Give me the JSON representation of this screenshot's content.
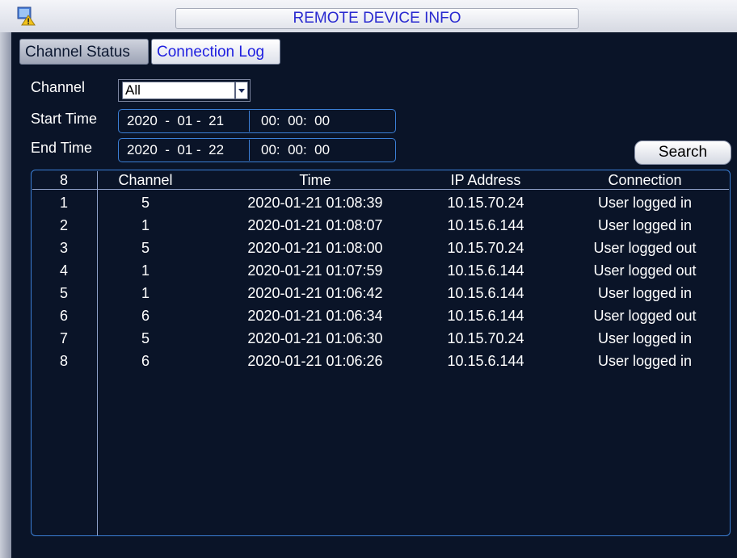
{
  "window": {
    "title": "REMOTE DEVICE INFO",
    "icon": "app-warning-icon"
  },
  "tabs": [
    {
      "label": "Channel Status",
      "active": false
    },
    {
      "label": "Connection Log",
      "active": true
    }
  ],
  "filters": {
    "channel_label": "Channel",
    "channel_value": "All",
    "start_label": "Start Time",
    "start_date": "2020  -  01 -  21",
    "start_time": "00:  00:  00",
    "end_label": "End Time",
    "end_date": "2020  -  01 -  22",
    "end_time": "00:  00:  00",
    "search_label": "Search"
  },
  "table": {
    "headers": [
      "8",
      "Channel",
      "Time",
      "IP Address",
      "Connection"
    ],
    "rows": [
      [
        "1",
        "5",
        "2020-01-21 01:08:39",
        "10.15.70.24",
        "User logged in"
      ],
      [
        "2",
        "1",
        "2020-01-21 01:08:07",
        "10.15.6.144",
        "User logged in"
      ],
      [
        "3",
        "5",
        "2020-01-21 01:08:00",
        "10.15.70.24",
        "User logged out"
      ],
      [
        "4",
        "1",
        "2020-01-21 01:07:59",
        "10.15.6.144",
        "User logged out"
      ],
      [
        "5",
        "1",
        "2020-01-21 01:06:42",
        "10.15.6.144",
        "User logged in"
      ],
      [
        "6",
        "6",
        "2020-01-21 01:06:34",
        "10.15.6.144",
        "User logged out"
      ],
      [
        "7",
        "5",
        "2020-01-21 01:06:30",
        "10.15.70.24",
        "User logged in"
      ],
      [
        "8",
        "6",
        "2020-01-21 01:06:26",
        "10.15.6.144",
        "User logged in"
      ]
    ]
  },
  "colors": {
    "background": "#0a1428",
    "accent_border": "#3b7fd6",
    "title_text": "#2a2ad0",
    "active_tab_text": "#2020e0"
  }
}
